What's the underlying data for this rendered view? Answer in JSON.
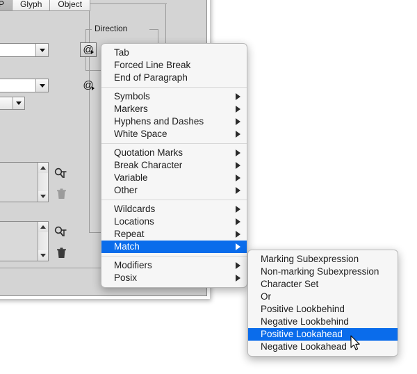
{
  "dialog": {
    "tabs": [
      {
        "label": "GREP",
        "active": true
      },
      {
        "label": "Glyph",
        "active": false
      },
      {
        "label": "Object",
        "active": false
      }
    ],
    "groupbox_label": "Direction",
    "at_button_glyph": "@",
    "at_button_glyph_2": "@",
    "find_combo_value": "",
    "change_combo_value": "",
    "options_combo_value": "",
    "found_list_value": "",
    "change_list_value": "",
    "icons": {
      "special_char_1": "at-special-character-icon",
      "special_char_2": "at-special-character-icon",
      "case_sensitive": "case-sensitive-icon",
      "find_format_1": "find-format-icon",
      "clear_format_1": "trash-icon",
      "find_format_2": "find-format-icon",
      "clear_format_2": "trash-icon"
    }
  },
  "menu_main": {
    "name": "special-characters-menu",
    "groups": [
      {
        "items": [
          {
            "label": "Tab",
            "submenu": false
          },
          {
            "label": "Forced Line Break",
            "submenu": false
          },
          {
            "label": "End of Paragraph",
            "submenu": false
          }
        ]
      },
      {
        "items": [
          {
            "label": "Symbols",
            "submenu": true
          },
          {
            "label": "Markers",
            "submenu": true
          },
          {
            "label": "Hyphens and Dashes",
            "submenu": true
          },
          {
            "label": "White Space",
            "submenu": true
          }
        ]
      },
      {
        "items": [
          {
            "label": "Quotation Marks",
            "submenu": true
          },
          {
            "label": "Break Character",
            "submenu": true
          },
          {
            "label": "Variable",
            "submenu": true
          },
          {
            "label": "Other",
            "submenu": true
          }
        ]
      },
      {
        "items": [
          {
            "label": "Wildcards",
            "submenu": true
          },
          {
            "label": "Locations",
            "submenu": true
          },
          {
            "label": "Repeat",
            "submenu": true
          },
          {
            "label": "Match",
            "submenu": true,
            "selected": true
          }
        ]
      },
      {
        "items": [
          {
            "label": "Modifiers",
            "submenu": true
          },
          {
            "label": "Posix",
            "submenu": true
          }
        ]
      }
    ]
  },
  "menu_sub": {
    "name": "match-submenu",
    "items": [
      {
        "label": "Marking Subexpression",
        "selected": false
      },
      {
        "label": "Non-marking Subexpression",
        "selected": false
      },
      {
        "label": "Character Set",
        "selected": false
      },
      {
        "label": "Or",
        "selected": false
      },
      {
        "label": "Positive Lookbehind",
        "selected": false
      },
      {
        "label": "Negative Lookbehind",
        "selected": false
      },
      {
        "label": "Positive Lookahead",
        "selected": true
      },
      {
        "label": "Negative Lookahead",
        "selected": false
      }
    ]
  },
  "colors": {
    "menu_background": "#f6f6f6",
    "menu_highlight": "#0a6ceb",
    "menu_highlight_text": "#ffffff",
    "panel_background": "#d4d4d4",
    "text": "#1d1d1d"
  }
}
